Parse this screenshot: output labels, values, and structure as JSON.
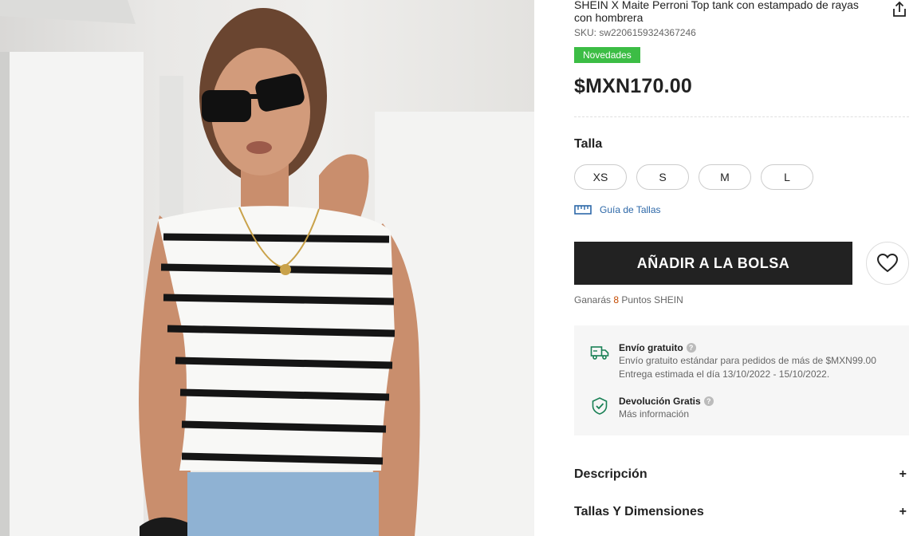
{
  "product": {
    "title": "SHEIN X Maite Perroni Top tank con estampado de rayas con hombrera",
    "sku": "SKU: sw2206159324367246",
    "badge": "Novedades",
    "price": "$MXN170.00"
  },
  "size_selector": {
    "label": "Talla",
    "options": [
      "XS",
      "S",
      "M",
      "L"
    ],
    "guide_label": "Guía de Tallas"
  },
  "actions": {
    "add_to_bag": "AÑADIR A LA BOLSA",
    "wishlist_icon": "heart-icon",
    "share_icon": "share-icon"
  },
  "points": {
    "prefix": "Ganarás ",
    "value": "8",
    "suffix": " Puntos SHEIN"
  },
  "shipping": {
    "free_title": "Envío gratuito",
    "free_line1": "Envío gratuito estándar para pedidos de más de $MXN99.00",
    "free_line2": "Entrega estimada el día 13/10/2022 - 15/10/2022.",
    "return_title": "Devolución Gratis",
    "return_link": "Más información",
    "help_glyph": "?"
  },
  "accordion": [
    {
      "title": "Descripción",
      "toggle": "+"
    },
    {
      "title": "Tallas Y Dimensiones",
      "toggle": "+"
    }
  ],
  "colors": {
    "badge": "#3cbd45",
    "button": "#222222",
    "link": "#2d68a8",
    "points": "#c44a01",
    "icon_green": "#198055"
  }
}
